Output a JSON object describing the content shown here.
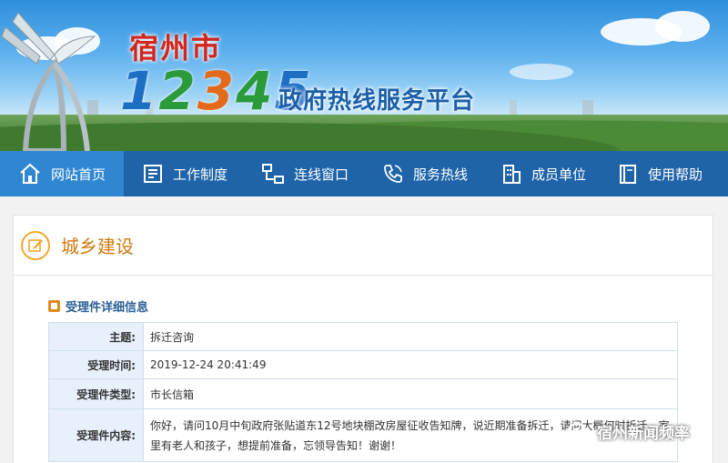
{
  "banner": {
    "city": "宿州市",
    "number_digits": [
      "1",
      "2",
      "3",
      "4",
      "5"
    ],
    "platform": "政府热线服务平台"
  },
  "nav": {
    "items": [
      {
        "label": "网站首页",
        "icon": "home-icon",
        "active": true
      },
      {
        "label": "工作制度",
        "icon": "document-list-icon",
        "active": false
      },
      {
        "label": "连线窗口",
        "icon": "network-icon",
        "active": false
      },
      {
        "label": "服务热线",
        "icon": "phone-icon",
        "active": false
      },
      {
        "label": "成员单位",
        "icon": "building-icon",
        "active": false
      },
      {
        "label": "使用帮助",
        "icon": "book-icon",
        "active": false
      }
    ]
  },
  "section": {
    "title": "城乡建设",
    "subtitle": "受理件详细信息"
  },
  "details": {
    "topic_label": "主题:",
    "topic_value": "拆迁咨询",
    "time_label": "受理时间:",
    "time_value": "2019-12-24 20:41:49",
    "type_label": "受理件类型:",
    "type_value": "市长信箱",
    "content_label": "受理件内容:",
    "content_value": "你好，请问10月中旬政府张贴道东12号地块棚改房屋征收告知牌，说近期准备拆迁，请问大概何时拆迁，家里有老人和孩子，想提前准备，忘领导告知！谢谢！"
  },
  "watermark": {
    "text": "宿州新闻频率"
  },
  "colors": {
    "nav_bg": "#1f63a8",
    "nav_active": "#2f87d1",
    "section_title": "#d07a10",
    "subtitle": "#2b5f96",
    "label_bg": "#e8f1fb"
  }
}
